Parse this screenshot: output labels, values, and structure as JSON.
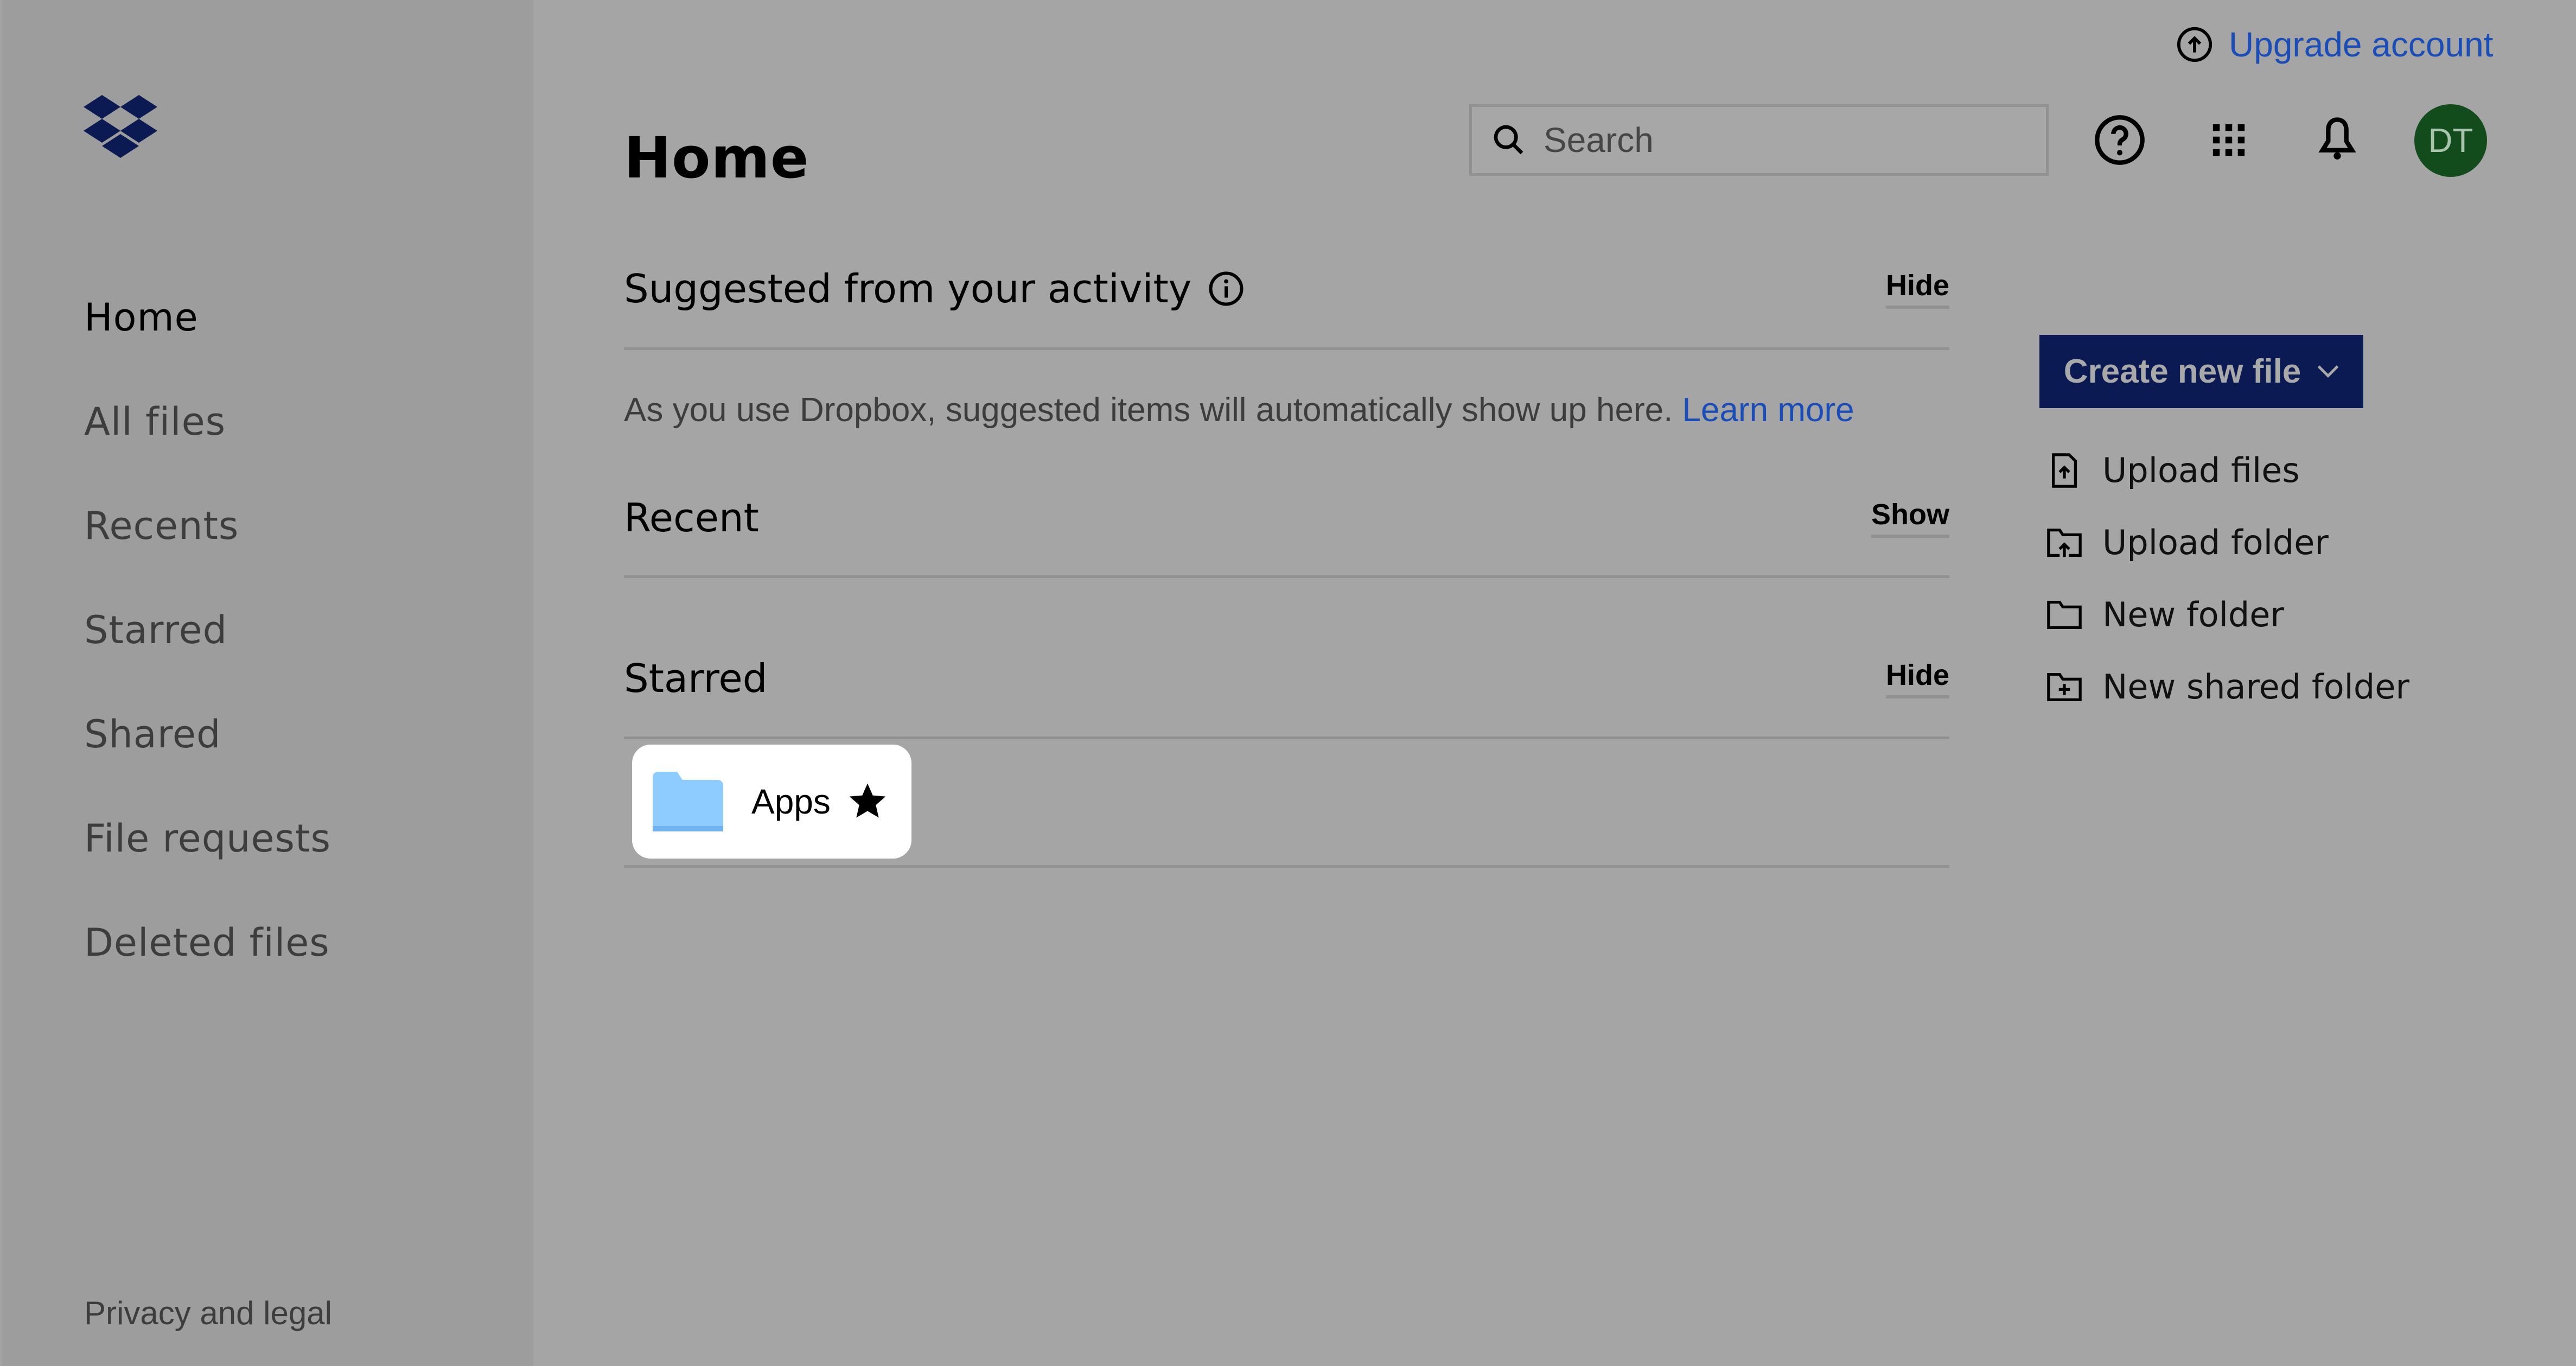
{
  "sidebar": {
    "items": [
      {
        "label": "Home",
        "active": true
      },
      {
        "label": "All files"
      },
      {
        "label": "Recents"
      },
      {
        "label": "Starred"
      },
      {
        "label": "Shared"
      },
      {
        "label": "File requests"
      },
      {
        "label": "Deleted files"
      }
    ],
    "footer_link": "Privacy and legal"
  },
  "header": {
    "title": "Home",
    "upgrade_label": "Upgrade account",
    "search_placeholder": "Search",
    "search_value": "",
    "avatar_initials": "DT"
  },
  "sections": {
    "suggested": {
      "title": "Suggested from your activity",
      "toggle": "Hide",
      "message": "As you use Dropbox, suggested items will automatically show up here.",
      "link": "Learn more"
    },
    "recent": {
      "title": "Recent",
      "toggle": "Show"
    },
    "starred": {
      "title": "Starred",
      "toggle": "Hide",
      "items": [
        {
          "name": "Apps",
          "type": "folder",
          "starred": true
        }
      ]
    }
  },
  "actions": {
    "create_label": "Create new file",
    "items": [
      {
        "label": "Upload files",
        "icon": "upload-file-icon"
      },
      {
        "label": "Upload folder",
        "icon": "upload-folder-icon"
      },
      {
        "label": "New folder",
        "icon": "folder-icon"
      },
      {
        "label": "New shared folder",
        "icon": "shared-folder-icon"
      }
    ]
  },
  "colors": {
    "brand": "#0b1a52",
    "link": "#1a4db8",
    "avatar": "#124b1c",
    "folder": "#8ecbff"
  }
}
